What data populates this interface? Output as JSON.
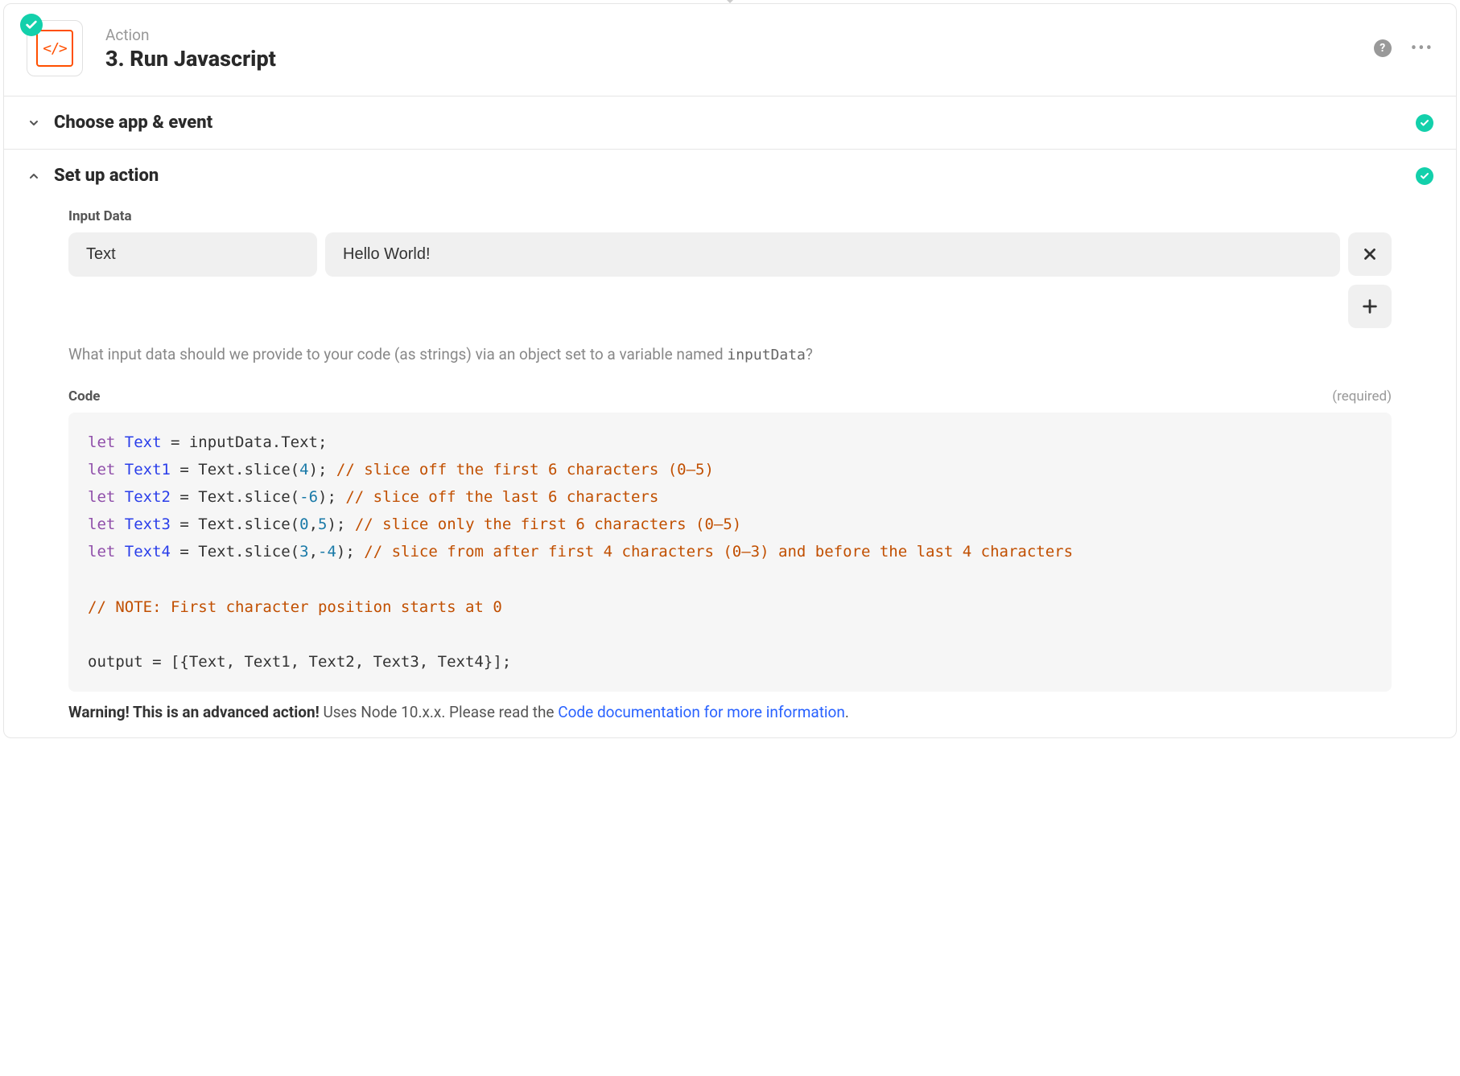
{
  "header": {
    "subtitle": "Action",
    "title": "3. Run Javascript",
    "icon_text": "</>"
  },
  "sections": {
    "choose": {
      "title": "Choose app & event"
    },
    "setup": {
      "title": "Set up action"
    }
  },
  "input_data": {
    "label": "Input Data",
    "rows": [
      {
        "key": "Text",
        "value": "Hello World!"
      }
    ],
    "help_prefix": "What input data should we provide to your code (as strings) via an object set to a variable named ",
    "help_var": "inputData",
    "help_suffix": "?"
  },
  "code": {
    "label": "Code",
    "required_label": "(required)",
    "lines": [
      {
        "prefix": "let ",
        "var": "Text",
        "rest": " = inputData.Text;",
        "comment": ""
      },
      {
        "prefix": "let ",
        "var": "Text1",
        "rest": " = Text.slice(4); ",
        "comment": "// slice off the first 6 characters (0–5)"
      },
      {
        "prefix": "let ",
        "var": "Text2",
        "rest": " = Text.slice(-6); ",
        "comment": "// slice off the last 6 characters"
      },
      {
        "prefix": "let ",
        "var": "Text3",
        "rest": " = Text.slice(0,5); ",
        "comment": "// slice only the first 6 characters (0–5)"
      },
      {
        "prefix": "let ",
        "var": "Text4",
        "rest": " = Text.slice(3,-4); ",
        "comment": "// slice from after first 4 characters (0–3) and before the last 4 characters"
      },
      {
        "plain": ""
      },
      {
        "comment_only": "// NOTE: First character position starts at 0"
      },
      {
        "plain": ""
      },
      {
        "plain": "output = [{Text, Text1, Text2, Text3, Text4}];"
      }
    ]
  },
  "warning": {
    "bold": "Warning! This is an advanced action!",
    "text": " Uses Node 10.x.x. Please read the ",
    "link": "Code documentation for more information",
    "suffix": "."
  }
}
